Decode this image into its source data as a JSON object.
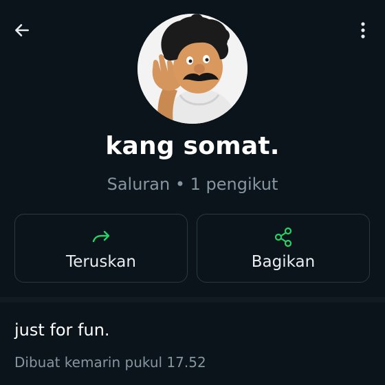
{
  "header": {
    "back_icon": "arrow-left-icon",
    "menu_icon": "more-vertical-icon"
  },
  "channel": {
    "name": "kang somat.",
    "meta": "Saluran • 1 pengikut",
    "avatar": "cartoon-character-avatar"
  },
  "actions": [
    {
      "label": "Teruskan",
      "icon": "forward-icon"
    },
    {
      "label": "Bagikan",
      "icon": "share-icon"
    }
  ],
  "about": {
    "description": "just for fun.",
    "created": "Dibuat kemarin pukul 17.52"
  },
  "colors": {
    "background": "#0b141a",
    "accent": "#25d366",
    "secondary_text": "#8696a0",
    "card_border": "#2a3942"
  }
}
